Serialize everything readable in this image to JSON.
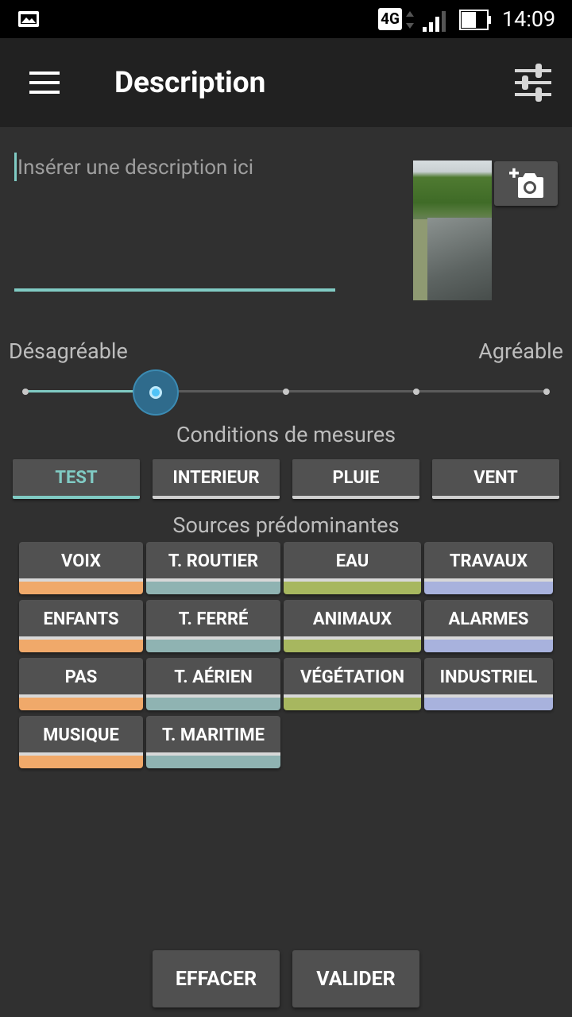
{
  "status_bar": {
    "network": "4G",
    "time": "14:09",
    "icons": [
      "gallery-icon",
      "data-arrows-icon",
      "signal-icon",
      "battery-icon"
    ]
  },
  "app_bar": {
    "title": "Description",
    "icons": [
      "menu-icon",
      "filter-sliders-icon"
    ]
  },
  "description": {
    "placeholder": "Insérer une description ici",
    "value": ""
  },
  "photo": {
    "icon": "add-photo-icon"
  },
  "slider": {
    "min_label": "Désagréable",
    "max_label": "Agréable",
    "steps": 5,
    "selected_index": 1
  },
  "conditions": {
    "title": "Conditions de mesures",
    "buttons": [
      {
        "label": "TEST",
        "active": true
      },
      {
        "label": "INTERIEUR",
        "active": false
      },
      {
        "label": "PLUIE",
        "active": false
      },
      {
        "label": "VENT",
        "active": false
      }
    ]
  },
  "sources": {
    "title": "Sources prédominantes",
    "colors": {
      "orange": "#f0a96a",
      "teal": "#8fb3b2",
      "olive": "#a7b75f",
      "lavender": "#a8b2dd"
    },
    "buttons": [
      {
        "label": "VOIX",
        "color": "orange"
      },
      {
        "label": "T. ROUTIER",
        "color": "teal"
      },
      {
        "label": "EAU",
        "color": "olive"
      },
      {
        "label": "TRAVAUX",
        "color": "lavender"
      },
      {
        "label": "ENFANTS",
        "color": "orange"
      },
      {
        "label": "T. FERRÉ",
        "color": "teal"
      },
      {
        "label": "ANIMAUX",
        "color": "olive"
      },
      {
        "label": "ALARMES",
        "color": "lavender"
      },
      {
        "label": "PAS",
        "color": "orange"
      },
      {
        "label": "T. AÉRIEN",
        "color": "teal"
      },
      {
        "label": "VÉGÉTATION",
        "color": "olive"
      },
      {
        "label": "INDUSTRIEL",
        "color": "lavender"
      },
      {
        "label": "MUSIQUE",
        "color": "orange"
      },
      {
        "label": "T. MARITIME",
        "color": "teal"
      }
    ]
  },
  "actions": {
    "clear_label": "EFFACER",
    "submit_label": "VALIDER"
  },
  "colors": {
    "accent": "#80cbc4",
    "background": "#303030",
    "app_bar": "#212121"
  }
}
